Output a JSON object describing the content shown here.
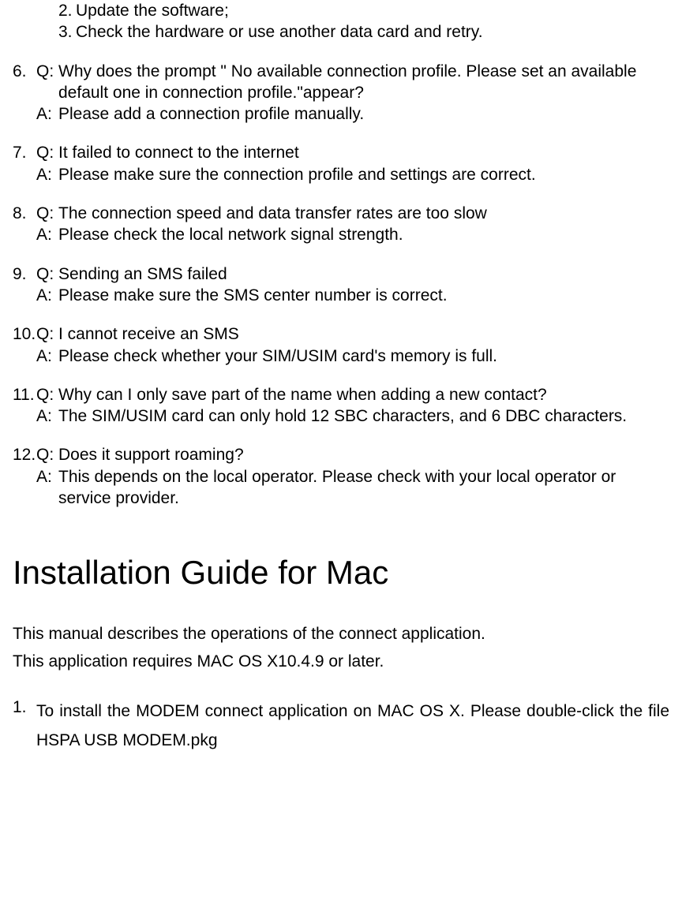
{
  "sublist": {
    "item2_num": "2.",
    "item2_text": "Update the software;",
    "item3_num": "3.",
    "item3_text": "Check the hardware or use another data card and retry."
  },
  "qa": [
    {
      "num": "6.",
      "q_label": "Q:",
      "q_text": "Why does the prompt \" No available connection profile. Please set an available default one in connection profile.\"appear?",
      "a_label": "A:",
      "a_text": "Please add a connection profile manually."
    },
    {
      "num": "7.",
      "q_label": "Q:",
      "q_text": "It failed to connect to the internet",
      "a_label": "A:",
      "a_text": "Please make sure the connection profile and settings are correct."
    },
    {
      "num": "8.",
      "q_label": "Q:",
      "q_text": "The connection speed and data transfer rates are too slow",
      "a_label": "A:",
      "a_text": "Please check the local network signal strength."
    },
    {
      "num": "9.",
      "q_label": "Q:",
      "q_text": "Sending an SMS failed",
      "a_label": "A:",
      "a_text": "Please make sure the SMS center number is correct."
    },
    {
      "num": "10.",
      "q_label": "Q:",
      "q_text": "I cannot receive an SMS",
      "a_label": "A:",
      "a_text": "Please check whether your SIM/USIM card's memory is full."
    },
    {
      "num": "11.",
      "q_label": "Q:",
      "q_text": "Why can I only save part of the name when adding a new contact?",
      "a_label": "A:",
      "a_text": "The SIM/USIM card can only hold 12 SBC characters, and 6 DBC characters."
    },
    {
      "num": "12.",
      "q_label": "Q:",
      "q_text": "Does it support roaming?",
      "a_label": "A:",
      "a_text": "This depends on the local operator. Please check with your local operator or service provider."
    }
  ],
  "section_title": "Installation Guide for Mac",
  "intro1": "This manual describes the operations of the connect application.",
  "intro2": "This application requires MAC OS X10.4.9 or later.",
  "install": {
    "num": "1.",
    "text": "To install the MODEM connect application on MAC OS X. Please double-click the file HSPA USB MODEM.pkg"
  }
}
